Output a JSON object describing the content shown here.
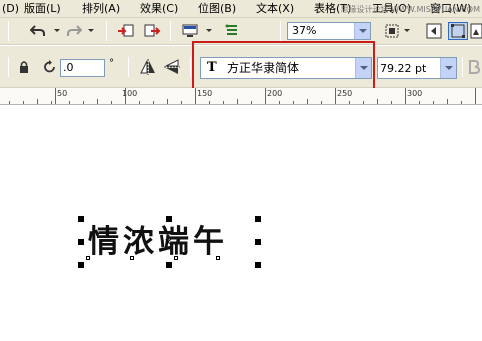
{
  "menu": {
    "items": [
      "(D)",
      "版面(L)",
      "排列(A)",
      "效果(C)",
      "位图(B)",
      "文本(X)",
      "表格(T)",
      "工具(O)",
      "窗口(W)"
    ]
  },
  "watermark": "思缘设计论坛 WWW.MISSVUAN.COM",
  "toolbar": {
    "zoom": "37%",
    "icons": [
      "undo-icon",
      "redo-icon",
      "import-icon",
      "export-icon",
      "application-launcher-icon",
      "welcome-icon",
      "full-screen-preview-icon",
      "snap-to-icon"
    ]
  },
  "properties": {
    "angle_value": ".0",
    "degree_symbol": "°",
    "font_icon": "T",
    "font_name": "方正华隶简体",
    "font_size": "79.22 pt"
  },
  "ruler": {
    "labels": [
      "50",
      "100",
      "150",
      "200",
      "250",
      "300"
    ]
  },
  "canvas": {
    "artistic_text": "情浓端午",
    "center_marker": "×"
  },
  "colors": {
    "highlight": "#cc1b1b",
    "chrome": "#ece9d8"
  }
}
